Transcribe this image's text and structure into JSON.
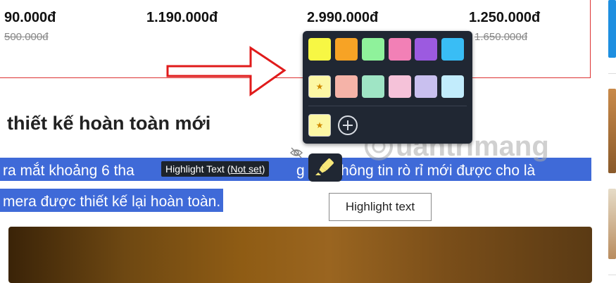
{
  "prices": [
    {
      "current": "90.000đ",
      "old": "500.000đ"
    },
    {
      "current": "1.190.000đ",
      "old": ""
    },
    {
      "current": "2.990.000đ",
      "old": ""
    },
    {
      "current": "1.250.000đ",
      "old": "1.650.000đ"
    }
  ],
  "article": {
    "heading": "thiết kế hoàn toàn mới",
    "line1_left": "ra mắt khoảng 6 tha",
    "line1_mid": "g n",
    "line1_right": "hông tin rò rỉ mới được cho là",
    "line2": "mera được thiết kế lại hoàn toàn."
  },
  "palette": {
    "row1": [
      "#f7f744",
      "#f7a325",
      "#8ff29b",
      "#f280b6",
      "#9c5ae0",
      "#39bdf5"
    ],
    "row2": [
      "#fcf7a4",
      "#f5b3a8",
      "#9fe5c5",
      "#f5c2d9",
      "#c9c0ef",
      "#c2ecfc"
    ],
    "custom": "#fcf7a4",
    "selected_icon": "star-icon",
    "add_icon": "plus-icon"
  },
  "tooltip_shortcut": {
    "label": "Highlight Text",
    "open_paren": "(",
    "shortcut": "Not set",
    "close_paren": ")"
  },
  "highlight_button": {
    "icon": "highlighter-icon"
  },
  "tooltip_hover": {
    "text": "Highlight text"
  },
  "watermark": {
    "text": "uantrimang"
  },
  "colors": {
    "selection": "#3f6ad8",
    "accent_red": "#d33333"
  }
}
